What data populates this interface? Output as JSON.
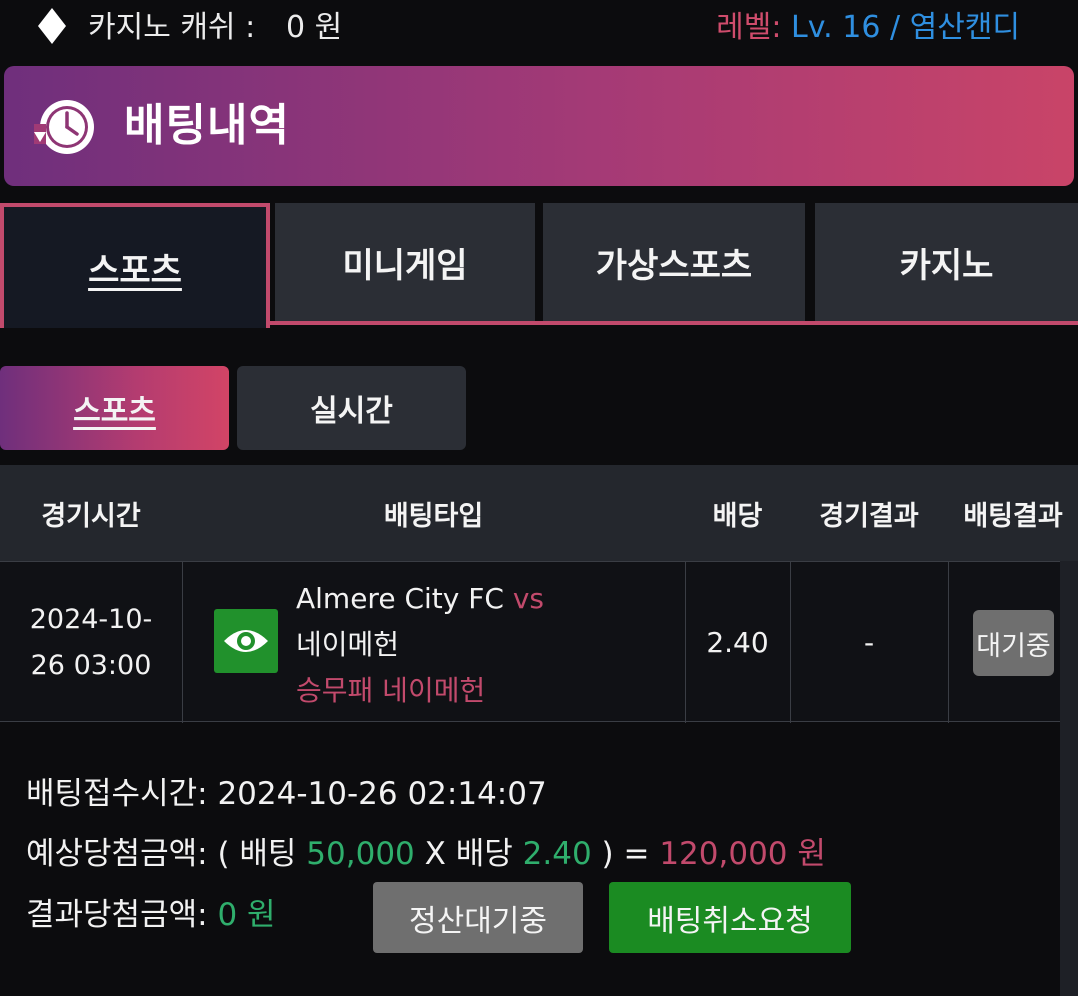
{
  "topbar": {
    "casino_cash_label": "카지노 캐쉬 :",
    "casino_cash_value": "0 원",
    "level_label": "레벨:",
    "level_value": "Lv. 16 / 염산캔디",
    "icon": "diamond-icon"
  },
  "banner": {
    "title": "배팅내역",
    "icon": "history-clock-icon"
  },
  "tabs": [
    {
      "label": "스포츠",
      "active": true
    },
    {
      "label": "미니게임",
      "active": false
    },
    {
      "label": "가상스포츠",
      "active": false
    },
    {
      "label": "카지노",
      "active": false
    }
  ],
  "subtabs": [
    {
      "label": "스포츠",
      "active": true
    },
    {
      "label": "실시간",
      "active": false
    }
  ],
  "table": {
    "headers": [
      "경기시간",
      "배팅타입",
      "배당",
      "경기결과",
      "배팅결과"
    ],
    "rows": [
      {
        "time_date": "2024-10-",
        "time_clock": "26 03:00",
        "icon": "eye-icon",
        "home": "Almere City FC",
        "vs": "vs",
        "away": "네이메헌",
        "pick": "승무패 네이메헌",
        "odds": "2.40",
        "match_result": "-",
        "bet_result": "대기중"
      }
    ]
  },
  "details": {
    "received_label": "배팅접수시간:",
    "received_value": "2024-10-26 02:14:07",
    "expected_label": "예상당첨금액:",
    "expected_open": "( 배팅",
    "expected_stake": "50,000",
    "expected_x": "X 배당",
    "expected_odds": "2.40",
    "expected_close": ") =",
    "expected_amount": "120,000 원",
    "result_label": "결과당첨금액:",
    "result_value": "0 원"
  },
  "buttons": {
    "settle": "정산대기중",
    "cancel": "배팅취소요청"
  },
  "colors": {
    "accent_pink": "#c24a6c",
    "green": "#2fae6c",
    "blue": "#2f8fe0",
    "button_green": "#1b8b22"
  }
}
